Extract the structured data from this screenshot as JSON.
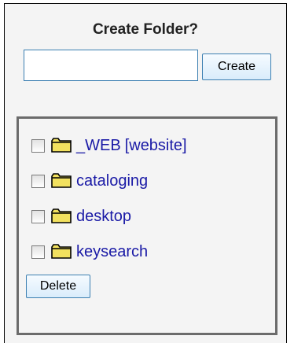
{
  "form": {
    "title": "Create Folder?",
    "folder_name_value": "",
    "create_label": "Create"
  },
  "folders": [
    {
      "name": "_WEB",
      "suffix": "[website]",
      "checked": false
    },
    {
      "name": "cataloging",
      "checked": false
    },
    {
      "name": "desktop",
      "checked": false
    },
    {
      "name": "keysearch",
      "checked": false
    }
  ],
  "delete_label": "Delete",
  "colors": {
    "panel_bg": "#f4f4f4",
    "link": "#1a1aa6",
    "button_border": "#3c7fb1",
    "folder_fill": "#f2e15f",
    "folder_outline": "#000000"
  },
  "icons": {
    "folder": "folder-icon",
    "checkbox": "checkbox-icon"
  }
}
